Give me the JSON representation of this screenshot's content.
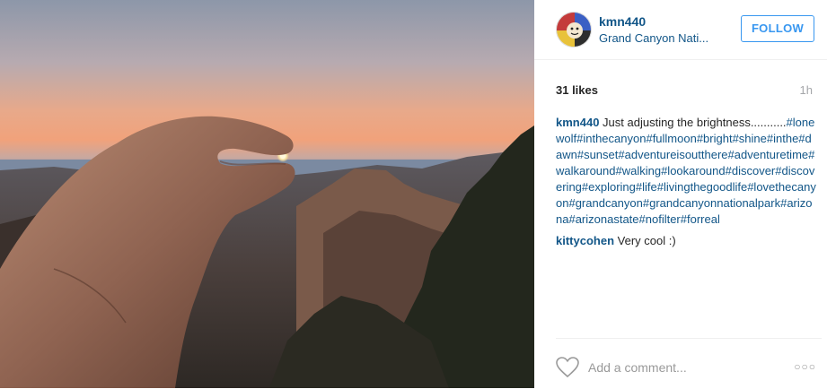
{
  "post": {
    "username": "kmn440",
    "location": "Grand Canyon Nati...",
    "follow_label": "FOLLOW",
    "likes": "31 likes",
    "time": "1h"
  },
  "caption": {
    "author": "kmn440",
    "text": "Just adjusting the brightness...........",
    "tags": "#lonewolf#inthecanyon#fullmoon#bright#shine#inthe#dawn#sunset#adventureisoutthere#adventuretime#walkaround#walking#lookaround#discover#discovering#exploring#life#livingthegoodlife#lovethecanyon#grandcanyon#grandcanyonnationalpark#arizona#arizonastate#nofilter#forreal"
  },
  "comments": [
    {
      "author": "kittycohen",
      "text": "Very cool :)"
    }
  ],
  "footer": {
    "add_comment_placeholder": "Add a comment...",
    "more_label": "○○○"
  },
  "icons": {
    "like": "heart-icon",
    "more": "more-options-icon"
  },
  "colors": {
    "link": "#125688",
    "follow": "#3897f0",
    "muted": "#999999"
  }
}
